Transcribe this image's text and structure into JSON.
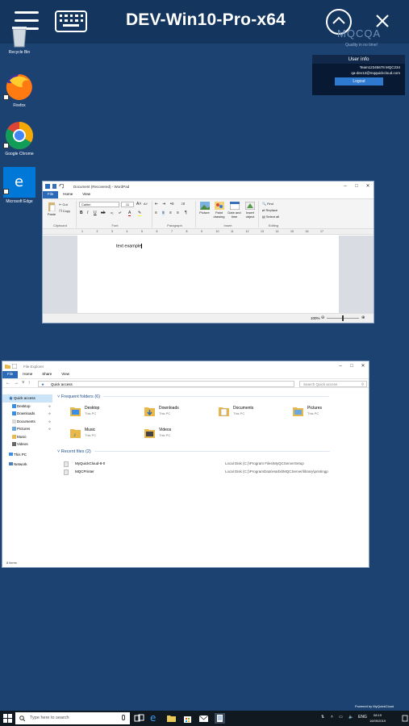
{
  "remote_bar": {
    "title": "DEV-Win10-Pro-x64",
    "brand": "MQCQA",
    "brand_tagline": "Quality in no time!"
  },
  "desktop": {
    "icons": [
      {
        "label": "Recycle Bin",
        "icon": "recycle-bin-icon"
      },
      {
        "label": "Firefox",
        "icon": "firefox-icon"
      },
      {
        "label": "Google Chrome",
        "icon": "chrome-icon"
      },
      {
        "label": "Microsoft Edge",
        "icon": "edge-icon"
      }
    ]
  },
  "user_info": {
    "title": "User info",
    "team": "Team12345678 MQC234",
    "email": "qa-dev12@mqquickcloud.com",
    "logout_label": "Logout"
  },
  "wordpad": {
    "title": "Document (Recovered) - WordPad",
    "tabs": [
      "File",
      "Home",
      "View"
    ],
    "active_tab": "File",
    "clipboard": {
      "paste": "Paste",
      "cut": "Cut",
      "copy": "Copy",
      "label": "Clipboard"
    },
    "font": {
      "family": "Calibri",
      "size": "11",
      "label": "Font"
    },
    "paragraph_label": "Paragraph",
    "insert": {
      "picture": "Picture",
      "paint": "Paint drawing",
      "datetime": "Date and time",
      "object": "Insert object",
      "label": "Insert"
    },
    "editing": {
      "find": "Find",
      "replace": "Replace",
      "select_all": "Select all",
      "label": "Editing"
    },
    "ruler_marks": [
      "1",
      "2",
      "3",
      "4",
      "5",
      "6",
      "7",
      "8",
      "9",
      "10",
      "11",
      "12",
      "13",
      "14",
      "15",
      "16",
      "17"
    ],
    "document_text": "text example",
    "zoom": "100%"
  },
  "explorer": {
    "title": "File Explorer",
    "tabs": [
      "File",
      "Home",
      "Share",
      "View"
    ],
    "active_tab": "File",
    "address": "Quick access",
    "search_placeholder": "Search Quick access",
    "nav": {
      "quick_access": "Quick access",
      "items": [
        "Desktop",
        "Downloads",
        "Documents",
        "Pictures",
        "Music",
        "Videos"
      ],
      "this_pc": "This PC",
      "network": "Network"
    },
    "frequent_header": "Frequent folders (6)",
    "folders": [
      {
        "name": "Desktop",
        "sub": "This PC"
      },
      {
        "name": "Downloads",
        "sub": "This PC"
      },
      {
        "name": "Documents",
        "sub": "This PC"
      },
      {
        "name": "Pictures",
        "sub": "This PC"
      },
      {
        "name": "Music",
        "sub": "This PC"
      },
      {
        "name": "Videos",
        "sub": "This PC"
      }
    ],
    "recent_header": "Recent files (2)",
    "recent": [
      {
        "name": "MyQuickCloud-8-0",
        "path": "Local Disk (C:)\\Program Files\\MyQCServerSetup"
      },
      {
        "name": "MQCPrinter",
        "path": "Local Disk (C:)\\ProgramData\\Harbit\\MQCServer\\library\\printingp"
      }
    ],
    "status": "8 items"
  },
  "taskbar": {
    "search_placeholder": "Type here to search",
    "language": "ENG",
    "time": "08:19",
    "date": "16/09/2019",
    "powered_by": "Powered by MyQuickCloud"
  }
}
